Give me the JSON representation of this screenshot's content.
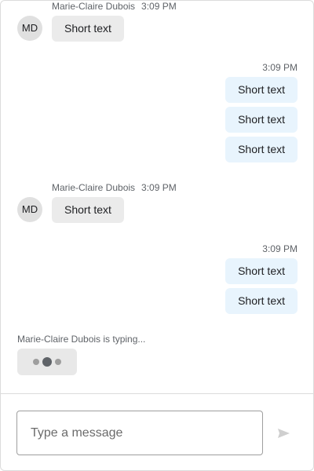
{
  "contact": {
    "name": "Marie-Claire Dubois",
    "initials": "MD"
  },
  "messages": [
    {
      "direction": "incoming",
      "time": "3:09 PM",
      "bubbles": [
        "Short text"
      ]
    },
    {
      "direction": "outgoing",
      "time": "3:09 PM",
      "bubbles": [
        "Short text",
        "Short text",
        "Short text"
      ]
    },
    {
      "direction": "incoming",
      "time": "3:09 PM",
      "bubbles": [
        "Short text"
      ]
    },
    {
      "direction": "outgoing",
      "time": "3:09 PM",
      "bubbles": [
        "Short text",
        "Short text"
      ]
    }
  ],
  "typing": {
    "label": "Marie-Claire Dubois is typing..."
  },
  "composer": {
    "placeholder": "Type a message",
    "value": "",
    "send_icon": "send-icon"
  },
  "colors": {
    "incoming_bubble": "#ebebeb",
    "outgoing_bubble": "#e8f4fd",
    "border": "#dcdcdc"
  }
}
